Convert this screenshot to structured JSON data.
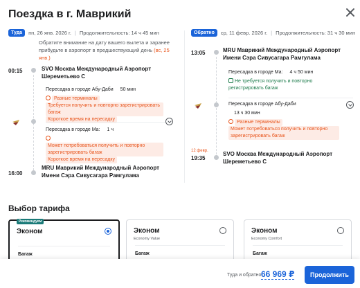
{
  "modal": {
    "title": "Поездка в г. Маврикий"
  },
  "outbound": {
    "badge": "Туда",
    "date": "пн, 26 янв. 2026 г.",
    "duration": "Продолжительность: 14 ч 45 мин",
    "note_prefix": "Обратите внимание на дату вашего вылета и заранее прибудьте в аэропорт в предшествующий день",
    "note_highlight": "(вс, 25 янв.)",
    "departure_time": "00:15",
    "departure_airport": "SVO Москва Международный Аэропорт Шереметьево С",
    "transfer1": {
      "city": "Пересадка в городе Абу-Даби",
      "duration": "50 мин",
      "warn_a": "Разные терминалы",
      "warn_b": "Требуется получить и повторно зарегистрировать багаж",
      "warn_c": "Короткое время на пересадку"
    },
    "transfer2": {
      "city": "Пересадка в городе Ма:",
      "duration": "1 ч",
      "warn_a": "Может потребоваться получить и повторно зарегистрировать багаж",
      "warn_b": "Короткое время на пересадку"
    },
    "arrival_time": "16:00",
    "arrival_airport": "MRU Маврикий Международный Аэропорт Имени Сэра Сивусагара Рамгулама"
  },
  "inbound": {
    "badge": "Обратно",
    "date": "ср, 11 февр. 2026 г.",
    "duration": "Продолжительность: 31 ч 30 мин",
    "departure_time": "13:05",
    "departure_airport": "MRU Маврикий Международный Аэропорт Имени Сэра Сивусагара Рамгулама",
    "transfer1": {
      "city": "Пересадка в городе Ма:",
      "duration": "4 ч 50 мин",
      "ok": "Не требуется получить и повторно регистрировать багаж"
    },
    "transfer2": {
      "city": "Пересадка в городе Абу-Даби",
      "duration": "13 ч 30 мин",
      "warn_a": "Разные терминалы",
      "warn_b": "Может потребоваться получить и повторно зарегистрировать багаж"
    },
    "arrival_date": "12 февр.",
    "arrival_time": "19:35",
    "arrival_airport": "SVO Москва Международный Аэропорт Шереметьево С"
  },
  "tariffs": {
    "title": "Выбор тарифа",
    "baggage_label": "Багаж",
    "cards": [
      {
        "badge": "Рекомендуем",
        "name": "Эконом",
        "sub": "",
        "selected": true
      },
      {
        "badge": "",
        "name": "Эконом",
        "sub": "Economy Value",
        "selected": false
      },
      {
        "badge": "",
        "name": "Эконом",
        "sub": "Economy Comfort",
        "selected": false
      }
    ]
  },
  "footer": {
    "label": "Туда и обратно",
    "price": "66 969 ₽",
    "cta": "Продолжить"
  },
  "colors": {
    "accent": "#1b64d9",
    "warning": "#e8541b",
    "success": "#1b7a4a",
    "recommended": "#1a7a78"
  }
}
